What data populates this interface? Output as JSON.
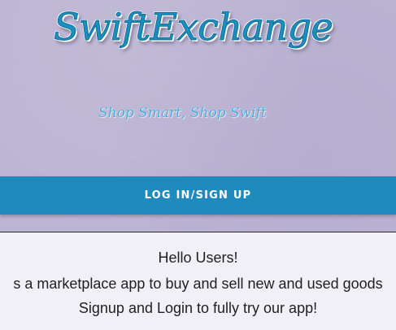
{
  "hero": {
    "logo_text": "SwiftExchange",
    "tagline": "Shop Smart, Shop Swift",
    "login_button_label": "LOG IN/SIGN UP"
  },
  "intro": {
    "greeting": "Hello Users!",
    "description": "s a marketplace app to buy and sell new and used goods",
    "call_to_action": "Signup and Login to fully try our app!"
  },
  "colors": {
    "hero_background": "#bcb4d3",
    "accent": "#1f8bbd",
    "content_background": "#f1f0f6"
  }
}
